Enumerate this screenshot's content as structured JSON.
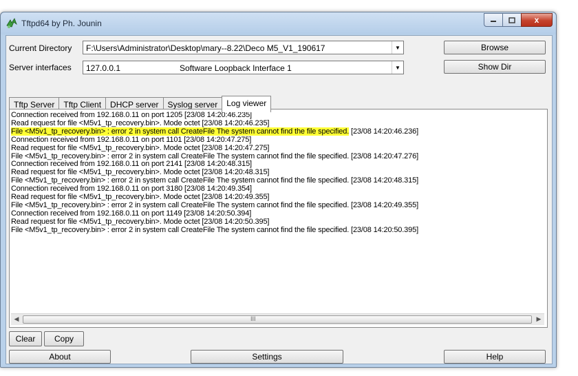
{
  "window": {
    "title": "Tftpd64 by Ph. Jounin",
    "close_glyph": "x"
  },
  "current_directory": {
    "label": "Current Directory",
    "value": "F:\\Users\\Administrator\\Desktop\\mary--8.22\\Deco M5_V1_190617",
    "browse_label": "Browse"
  },
  "server_interfaces": {
    "label": "Server interfaces",
    "ip": "127.0.0.1",
    "name": "Software Loopback Interface 1",
    "show_dir_label": "Show Dir"
  },
  "tabs": [
    {
      "label": "Tftp Server",
      "active": false
    },
    {
      "label": "Tftp Client",
      "active": false
    },
    {
      "label": "DHCP server",
      "active": false
    },
    {
      "label": "Syslog server",
      "active": false
    },
    {
      "label": "Log viewer",
      "active": true
    }
  ],
  "log": {
    "lines": [
      "Connection received from 192.168.0.11 on port 1205 [23/08 14:20:46.235]",
      "Read request for file <M5v1_tp_recovery.bin>. Mode octet [23/08 14:20:46.235]",
      "File <M5v1_tp_recovery.bin> : error 2 in system call CreateFile The system cannot find the file specified. [23/08 14:20:46.236]",
      "Connection received from 192.168.0.11 on port 1101 [23/08 14:20:47.275]",
      "Read request for file <M5v1_tp_recovery.bin>. Mode octet [23/08 14:20:47.275]",
      "File <M5v1_tp_recovery.bin> : error 2 in system call CreateFile The system cannot find the file specified. [23/08 14:20:47.276]",
      "Connection received from 192.168.0.11 on port 2141 [23/08 14:20:48.315]",
      "Read request for file <M5v1_tp_recovery.bin>. Mode octet [23/08 14:20:48.315]",
      "File <M5v1_tp_recovery.bin> : error 2 in system call CreateFile The system cannot find the file specified. [23/08 14:20:48.315]",
      "Connection received from 192.168.0.11 on port 3180 [23/08 14:20:49.354]",
      "Read request for file <M5v1_tp_recovery.bin>. Mode octet [23/08 14:20:49.355]",
      "File <M5v1_tp_recovery.bin> : error 2 in system call CreateFile The system cannot find the file specified. [23/08 14:20:49.355]",
      "Connection received from 192.168.0.11 on port 1149 [23/08 14:20:50.394]",
      "Read request for file <M5v1_tp_recovery.bin>. Mode octet [23/08 14:20:50.395]",
      "File <M5v1_tp_recovery.bin> : error 2 in system call CreateFile The system cannot find the file specified. [23/08 14:20:50.395]"
    ],
    "highlight": {
      "text": "File <M5v1_tp_recovery.bin> : error 2 in system call CreateFile The system cannot find the file specified.",
      "rest": " [23/08 14:20:46.236]",
      "color": "#ffff33"
    },
    "scroll_grip": "III"
  },
  "buttons": {
    "clear": "Clear",
    "copy": "Copy",
    "about": "About",
    "settings": "Settings",
    "help": "Help"
  },
  "icons": {
    "app": "tftpd-app-icon",
    "minimize": "minimize-icon",
    "maximize": "maximize-icon",
    "close": "close-icon",
    "dropdown": "chevron-down-icon"
  },
  "colors": {
    "titlebar": "#c4d8ee",
    "client_bg": "#f0f0f0",
    "highlight": "#ffff33"
  }
}
